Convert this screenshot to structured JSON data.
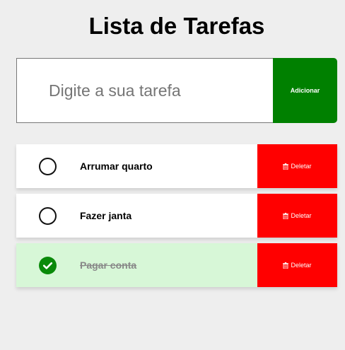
{
  "header": {
    "title": "Lista de Tarefas"
  },
  "add_form": {
    "placeholder": "Digite a sua tarefa",
    "value": "",
    "add_label": "Adicionar"
  },
  "colors": {
    "add_button": "#008000",
    "delete_button": "#ff0000",
    "done_background": "#d7f7d7",
    "check_done": "#0a8a0a"
  },
  "tasks": [
    {
      "label": "Arrumar quarto",
      "done": false,
      "delete_label": "Deletar",
      "delete_icon": "trash-icon"
    },
    {
      "label": "Fazer janta",
      "done": false,
      "delete_label": "Deletar",
      "delete_icon": "trash-icon"
    },
    {
      "label": "Pagar conta",
      "done": true,
      "delete_label": "Deletar",
      "delete_icon": "trash-icon"
    }
  ]
}
